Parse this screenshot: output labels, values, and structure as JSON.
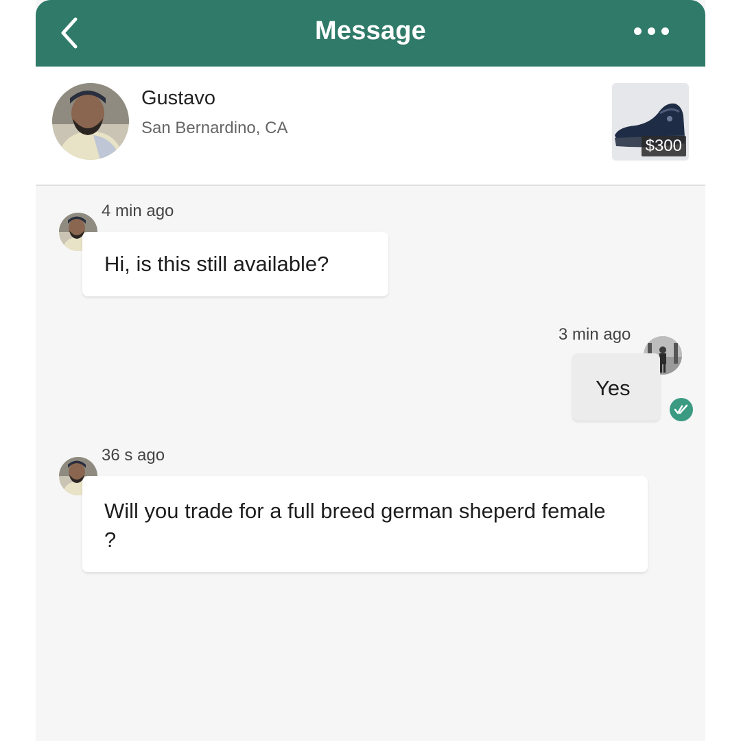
{
  "header": {
    "title": "Message",
    "back_icon": "chevron-left-icon",
    "more_icon": "more-horizontal-icon",
    "accent_color": "#2f7a68"
  },
  "seller": {
    "name": "Gustavo",
    "location": "San Bernardino, CA"
  },
  "listing": {
    "price": "$300",
    "thumbnail": "sneaker-image"
  },
  "messages": [
    {
      "direction": "incoming",
      "time": "4 min ago",
      "text": "Hi, is this still available?"
    },
    {
      "direction": "outgoing",
      "time": "3 min ago",
      "text": "Yes",
      "status_icon": "read-check-icon"
    },
    {
      "direction": "incoming",
      "time": "36 s ago",
      "text": "Will you trade for a full breed german sheperd female ?"
    }
  ]
}
